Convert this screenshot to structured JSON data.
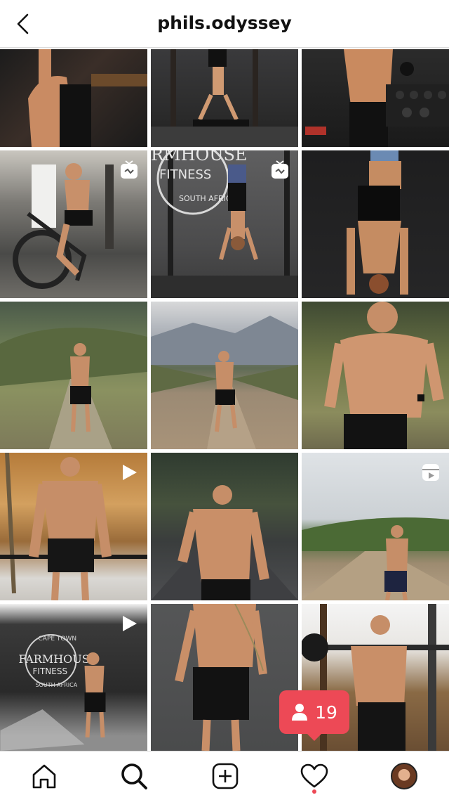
{
  "header": {
    "title": "phils.odyssey",
    "back_icon": "chevron-left-icon"
  },
  "grid": {
    "posts": [
      {
        "badge": "none"
      },
      {
        "badge": "none"
      },
      {
        "badge": "none"
      },
      {
        "badge": "igtv"
      },
      {
        "badge": "igtv"
      },
      {
        "badge": "none"
      },
      {
        "badge": "none"
      },
      {
        "badge": "none"
      },
      {
        "badge": "none"
      },
      {
        "badge": "video"
      },
      {
        "badge": "none"
      },
      {
        "badge": "reel"
      },
      {
        "badge": "video"
      },
      {
        "badge": "none"
      },
      {
        "badge": "none"
      }
    ],
    "sign_lines": [
      "RMHOUSE",
      "FITNESS",
      "SOUTH AFRICA"
    ],
    "sign2_lines": [
      "CAPE TOWN",
      "FARMHOUSE",
      "FITNESS",
      "SOUTH AFRICA"
    ]
  },
  "notification": {
    "count": "19",
    "icon": "person-icon"
  },
  "tabbar": {
    "items": [
      "home-icon",
      "search-icon",
      "new-post-icon",
      "heart-icon",
      "profile-avatar"
    ]
  },
  "colors": {
    "accent": "#ed4956",
    "divider": "#dbdbdb"
  }
}
